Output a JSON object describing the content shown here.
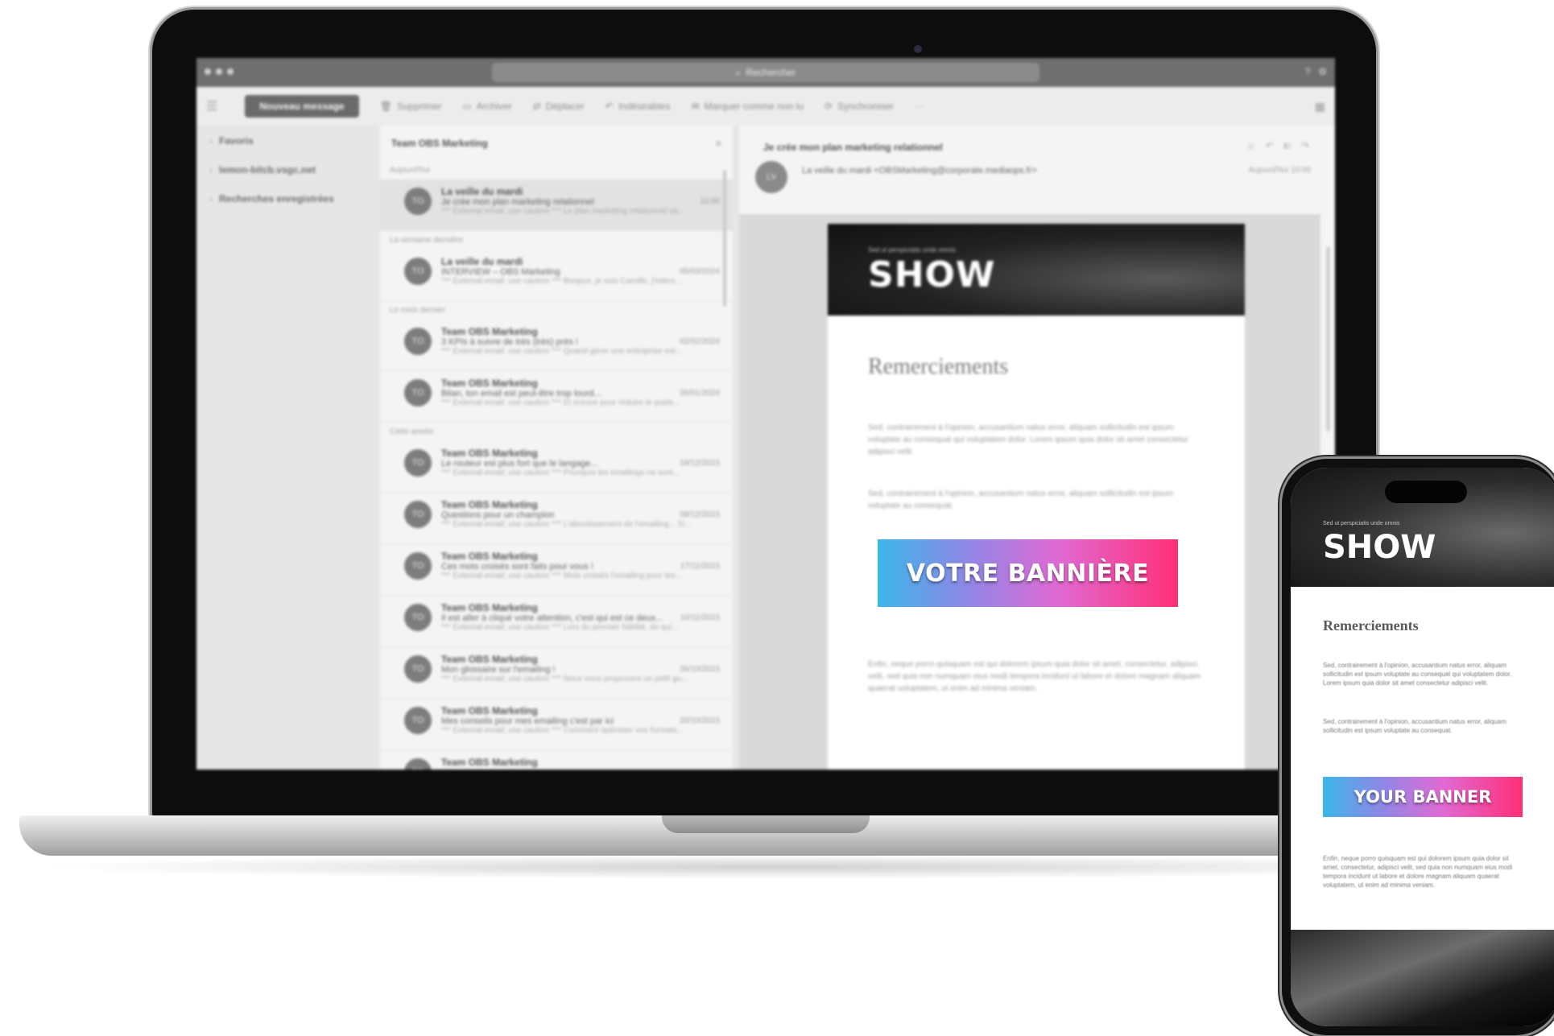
{
  "window": {
    "search_label": "Rechercher",
    "search_icon": "search-icon"
  },
  "toolbar": {
    "new_message": "Nouveau message",
    "actions": [
      {
        "icon": "trash-icon",
        "label": "Supprimer"
      },
      {
        "icon": "archive-icon",
        "label": "Archiver"
      },
      {
        "icon": "move-icon",
        "label": "Déplacer"
      },
      {
        "icon": "reply-icon",
        "label": "Indésirables"
      },
      {
        "icon": "flag-icon",
        "label": "Marquer comme non lu"
      },
      {
        "icon": "sync-icon",
        "label": "Synchroniser"
      }
    ],
    "more": "···"
  },
  "folders": [
    {
      "label": "Favoris"
    },
    {
      "label": "lemon-bitcb.vsgc.net"
    },
    {
      "label": "Recherches enregistrées"
    }
  ],
  "list": {
    "title": "Team OBS Marketing",
    "groups": {
      "g1": "Aujourd'hui",
      "g2": "La semaine dernière",
      "g3": "Le mois dernier",
      "g4": "Cette année"
    },
    "items": [
      {
        "avatar": "TO",
        "from": "La veille du mardi",
        "subject": "Je crée mon plan marketing relationnel",
        "date": "10:00",
        "preview": "*** External email: use caution *** Le plan marketing relationnel va..."
      },
      {
        "avatar": "TO",
        "from": "La veille du mardi",
        "subject": "INTERVIEW – OBS Marketing",
        "date": "05/03/2024",
        "preview": "*** External email: use caution *** Bonjour, je suis Camille, j'intère..."
      },
      {
        "avatar": "TO",
        "from": "Team OBS Marketing",
        "subject": "3 KPIs à suivre de très (très) près !",
        "date": "02/02/2024",
        "preview": "*** External email: use caution *** Quand gérer une entreprise est..."
      },
      {
        "avatar": "TO",
        "from": "Team OBS Marketing",
        "subject": "Bilan, ton email est peut-être trop lourd...",
        "date": "26/01/2024",
        "preview": "*** External email: use caution *** Et encore pour réduire le poids..."
      },
      {
        "avatar": "TO",
        "from": "Team OBS Marketing",
        "subject": "Le routeur est plus fort que le langage...",
        "date": "19/12/2023",
        "preview": "*** External email: use caution *** Pourquoi les emailings ne sont..."
      },
      {
        "avatar": "TO",
        "from": "Team OBS Marketing",
        "subject": "Questions pour un champion",
        "date": "08/12/2023",
        "preview": "*** External email: use caution *** L'aboutissement de l'emailing... Si..."
      },
      {
        "avatar": "TO",
        "from": "Team OBS Marketing",
        "subject": "Ces mots croisés sont faits pour vous !",
        "date": "17/11/2023",
        "preview": "*** External email: use caution *** Mots croisés l'emailing pour les..."
      },
      {
        "avatar": "TO",
        "from": "Team OBS Marketing",
        "subject": "Il est aller à cliqué votre attention, c'est qui est ce deux...",
        "date": "10/11/2023",
        "preview": "*** External email: use caution *** Lors du premier fidélité, de qui..."
      },
      {
        "avatar": "TO",
        "from": "Team OBS Marketing",
        "subject": "Mon glossaire sur l'emailing !",
        "date": "26/10/2023",
        "preview": "*** External email: use caution *** Nous vous proposons un petit gu..."
      },
      {
        "avatar": "TO",
        "from": "Team OBS Marketing",
        "subject": "Mes conseils pour mes emailing c'est par ici",
        "date": "20/10/2023",
        "preview": "*** External email: use caution *** Comment optimiser vos formats..."
      },
      {
        "avatar": "TO",
        "from": "Team OBS Marketing",
        "subject": "",
        "date": "",
        "preview": ""
      }
    ]
  },
  "reading": {
    "subject": "Je crée mon plan marketing relationnel",
    "sender": "La veille du mardi <OBSMarketing@corporate.mediaops.fr>",
    "date": "Aujourd'hui 10:00",
    "avatar": "LV"
  },
  "email": {
    "brand": "SHOW",
    "brand_small": "Sed ut perspiciatis unde omnis",
    "title": "Remerciements",
    "p1": "Sed, contrairement à l'opinion, accusantium natus error, aliquam sollicitudin est ipsum voluptate au consequat qui voluptatem dolor. Lorem ipsum quia dolor sit amet consectetur adipisci velit.",
    "p2": "Sed, contrairement à l'opinion, accusantium natus error, aliquam sollicitudin est ipsum voluptate au consequat.",
    "p3": "Enfin, neque porro quisquam est qui dolorem ipsum quia dolor sit amet, consectetur, adipisci velit, sed quia non numquam eius modi tempora incidunt ut labore et dolore magnam aliquam quaerat voluptatem, ut enim ad minima veniam.",
    "banner_desktop": "VOTRE BANNIÈRE",
    "banner_mobile": "YOUR BANNER"
  }
}
